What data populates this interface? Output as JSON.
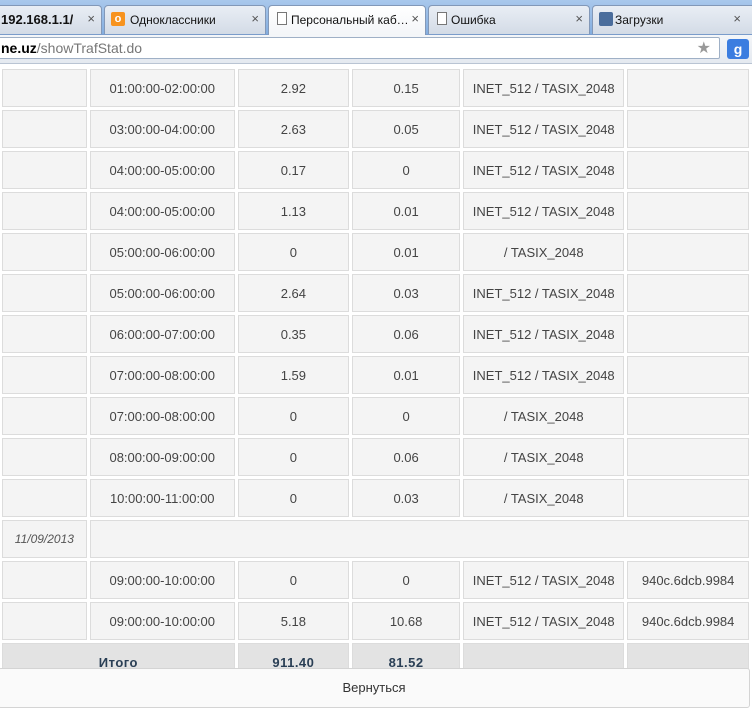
{
  "browser": {
    "tabs": [
      {
        "label": "192.168.1.1/",
        "icon": "none"
      },
      {
        "label": "Одноклассники",
        "icon": "odnoklassniki-icon"
      },
      {
        "label": "Персональный каб…",
        "icon": "document-icon"
      },
      {
        "label": "Ошибка",
        "icon": "document-icon"
      },
      {
        "label": "Загрузки",
        "icon": "downloads-icon"
      }
    ],
    "close_glyph": "×",
    "address": {
      "host": "ne.uz",
      "path": "/showTrafStat.do"
    },
    "star_glyph": "★",
    "extension_glyph": "g"
  },
  "table": {
    "rows": [
      {
        "date": "",
        "time": "01:00:00-02:00:00",
        "in": "2.92",
        "out": "0.15",
        "tariff": "INET_512 / TASIX_2048",
        "mac": ""
      },
      {
        "date": "",
        "time": "03:00:00-04:00:00",
        "in": "2.63",
        "out": "0.05",
        "tariff": "INET_512 / TASIX_2048",
        "mac": ""
      },
      {
        "date": "",
        "time": "04:00:00-05:00:00",
        "in": "0.17",
        "out": "0",
        "tariff": "INET_512 / TASIX_2048",
        "mac": ""
      },
      {
        "date": "",
        "time": "04:00:00-05:00:00",
        "in": "1.13",
        "out": "0.01",
        "tariff": "INET_512 / TASIX_2048",
        "mac": ""
      },
      {
        "date": "",
        "time": "05:00:00-06:00:00",
        "in": "0",
        "out": "0.01",
        "tariff": "/ TASIX_2048",
        "mac": ""
      },
      {
        "date": "",
        "time": "05:00:00-06:00:00",
        "in": "2.64",
        "out": "0.03",
        "tariff": "INET_512 / TASIX_2048",
        "mac": ""
      },
      {
        "date": "",
        "time": "06:00:00-07:00:00",
        "in": "0.35",
        "out": "0.06",
        "tariff": "INET_512 / TASIX_2048",
        "mac": ""
      },
      {
        "date": "",
        "time": "07:00:00-08:00:00",
        "in": "1.59",
        "out": "0.01",
        "tariff": "INET_512 / TASIX_2048",
        "mac": ""
      },
      {
        "date": "",
        "time": "07:00:00-08:00:00",
        "in": "0",
        "out": "0",
        "tariff": "/ TASIX_2048",
        "mac": ""
      },
      {
        "date": "",
        "time": "08:00:00-09:00:00",
        "in": "0",
        "out": "0.06",
        "tariff": "/ TASIX_2048",
        "mac": ""
      },
      {
        "date": "",
        "time": "10:00:00-11:00:00",
        "in": "0",
        "out": "0.03",
        "tariff": "/ TASIX_2048",
        "mac": ""
      }
    ],
    "date_row": "11/09/2013",
    "rows2": [
      {
        "date": "",
        "time": "09:00:00-10:00:00",
        "in": "0",
        "out": "0",
        "tariff": "INET_512 / TASIX_2048",
        "mac": "940c.6dcb.9984"
      },
      {
        "date": "",
        "time": "09:00:00-10:00:00",
        "in": "5.18",
        "out": "10.68",
        "tariff": "INET_512 / TASIX_2048",
        "mac": "940c.6dcb.9984"
      }
    ],
    "total": {
      "label": "Итого",
      "in": "911.40",
      "out": "81.52"
    }
  },
  "back_button": "Вернуться"
}
